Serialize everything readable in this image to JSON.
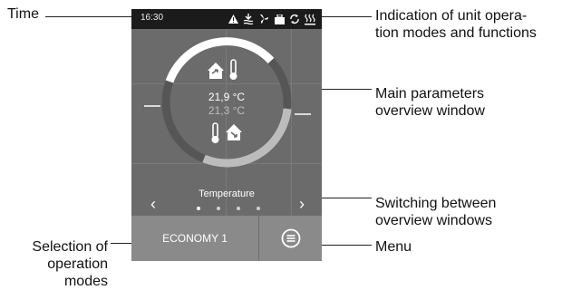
{
  "annotations": {
    "time": "Time",
    "indication": [
      "Indication of unit opera-",
      "tion modes and functions"
    ],
    "main_parameters": [
      "Main parameters",
      "overview window"
    ],
    "switching": [
      "Switching between",
      "overview windows"
    ],
    "selection": [
      "Selection of",
      "operation",
      "modes"
    ],
    "menu": "Menu"
  },
  "device": {
    "time": "16:30",
    "status_icons": [
      "warning-icon",
      "heat-exchanger-icon",
      "fan-icon",
      "filter-icon",
      "recycle-icon",
      "heater-icon"
    ],
    "temperature_supply": "21,9 °C",
    "temperature_extract": "21,3 °C",
    "carousel_title": "Temperature",
    "carousel_pages": 4,
    "carousel_active_page": 1,
    "mode_label": "ECONOMY 1",
    "prev_glyph": "‹",
    "next_glyph": "›"
  },
  "colors": {
    "screen_bg": "#6b6b6b",
    "status_bar": "#1b1b1b",
    "bottom_bar": "#8a8a8a",
    "arc_white": "#ffffff",
    "arc_light": "#bcbcbc",
    "arc_dark": "#565656"
  }
}
